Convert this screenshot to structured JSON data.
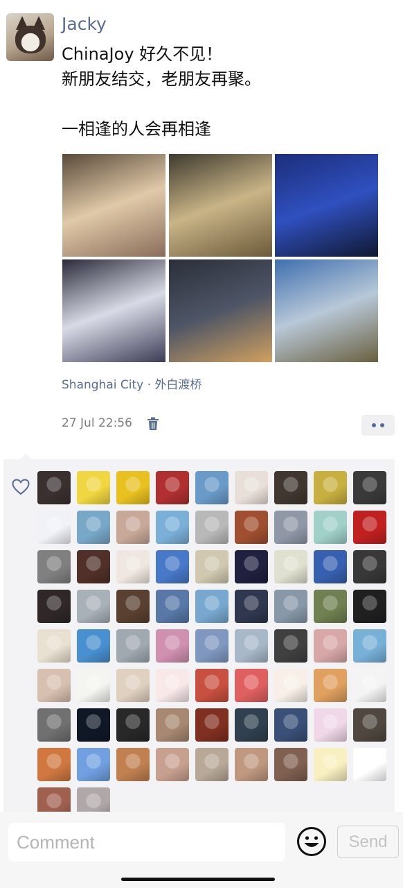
{
  "post": {
    "author": "Jacky",
    "text": "ChinaJoy 好久不见！\n新朋友结交，老朋友再聚。\n\n一相逢的人会再相逢",
    "location": "Shanghai City · 外白渡桥",
    "timestamp": "27 Jul 22:56",
    "photos": [
      {
        "name": "group-selfie-photo",
        "colors": [
          "#5a4a3a",
          "#e0c9a8",
          "#8a6d5a"
        ]
      },
      {
        "name": "banquet-hall-photo",
        "colors": [
          "#3e3a2e",
          "#c9b487",
          "#6b5a3a"
        ]
      },
      {
        "name": "conference-stage-photo",
        "colors": [
          "#1c2e7a",
          "#3050c0",
          "#101830"
        ]
      },
      {
        "name": "panel-discussion-photo",
        "colors": [
          "#2a2a3a",
          "#d8dbe6",
          "#3c3c56"
        ]
      },
      {
        "name": "shanghai-night-skyline-photo",
        "colors": [
          "#2b2f3a",
          "#4e5566",
          "#d0a060"
        ]
      },
      {
        "name": "sunset-clouds-photo",
        "colors": [
          "#3f6fb0",
          "#b8c8d8",
          "#6a6040"
        ]
      }
    ]
  },
  "likes": {
    "avatars": [
      [
        "#3a3030",
        "#f0d640",
        "#e8c020",
        "#b03030",
        "#6a9ac8",
        "#e8e0d8",
        "#403830",
        "#c8b040",
        "#3a3a3a"
      ],
      [
        "#f0f2f8",
        "#78a8c8",
        "#c8a898",
        "#7ab0d8",
        "#b8b8b8",
        "#a05030",
        "#9098a8",
        "#a0d0c8",
        "#c02020"
      ],
      [
        "#808080",
        "#503028",
        "#f0e8e0",
        "#4878c8",
        "#d0c8b0",
        "#202040",
        "#e0e0d0",
        "#3860b0",
        "#383838"
      ],
      [
        "#302828",
        "#a8b0b8",
        "#5a4030",
        "#5878a8",
        "#78a8d0",
        "#303850",
        "#8898a8",
        "#708050",
        "#202020"
      ],
      [
        "#e8e0d0",
        "#4890d0",
        "#a0a8b0",
        "#d090b0",
        "#8098c0",
        "#a8b8c8",
        "#404040",
        "#d8a8a8",
        "#78b0d8"
      ],
      [
        "#d8c0b0",
        "#f4f4f0",
        "#e0d0c0",
        "#f8e8e8",
        "#c85040",
        "#e06060",
        "#f8f0e8",
        "#e0a060",
        "#f4f4f4"
      ],
      [
        "#707070",
        "#101828",
        "#282828",
        "#a88870",
        "#803020",
        "#304050",
        "#3a5078",
        "#f0d8e8",
        "#504840"
      ],
      [
        "#d07840",
        "#70a0e0",
        "#c08050",
        "#c8a090",
        "#b8a898",
        "#c09880",
        "#806050",
        "#f8f0c0",
        "#ffffff"
      ],
      [
        "#a06050",
        "#b0a8a8"
      ]
    ]
  },
  "composer": {
    "placeholder": "Comment",
    "send_label": "Send"
  }
}
